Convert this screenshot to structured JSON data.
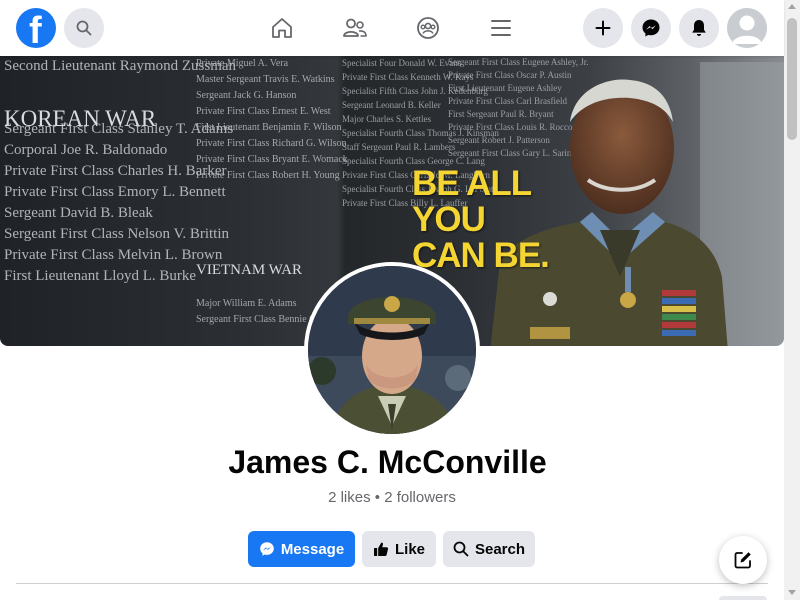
{
  "nav": {
    "logo_letter": "f",
    "icons": [
      "facebook-logo",
      "search-icon",
      "home-icon",
      "friends-icon",
      "groups-icon",
      "menu-icon",
      "plus-icon",
      "messenger-icon",
      "bell-icon",
      "account-avatar"
    ]
  },
  "cover": {
    "heading_korea": "KOREAN WAR",
    "heading_vietnam": "VIETNAM WAR",
    "slogan_line1": "BE ALL",
    "slogan_line2": "YOU",
    "slogan_line3": "CAN BE.",
    "names_left": "Second Lieutenant Raymond Zussman\n\n\nSergeant First Class Stanley T. Adams\nCorporal Joe R. Baldonado\nPrivate First Class Charles H. Barker\nPrivate First Class Emory L. Bennett\nSergeant David B. Bleak\nSergeant First Class Nelson V. Brittin\nPrivate First Class Melvin L. Brown\nFirst Lieutenant Lloyd L. Burke",
    "names_mid": "Private Miguel A. Vera\nMaster Sergeant Travis E. Watkins\nSergeant Jack G. Hanson\nPrivate First Class Ernest E. West\nFirst Lieutenant Benjamin F. Wilson\nPrivate First Class Richard G. Wilson\nPrivate First Class Bryant E. Womack\nPrivate First Class Robert H. Young",
    "names_vietnam": "Major William E. Adams\nSergeant First Class Bennie G. Adkins",
    "names_mid2": "Specialist Four Donald W. Evans\nPrivate First Class Kenneth W. Kays\nSpecialist Fifth Class John J. Kedenburg\nSergeant Leonard B. Keller\nMajor Charles S. Kettles\nSpecialist Fourth Class Thomas J. Kinsman\nStaff Sergeant Paul R. Lambers\nSpecialist Fourth Class George C. Lang\nPrivate First Class Garfield M. Langhorn\nSpecialist Fourth Class Joseph G. LaPointe\nPrivate First Class Billy L. Lauffer",
    "names_right": "Sergeant First Class Eugene Ashley, Jr.\nPrivate First Class Oscar P. Austin\nFirst Lieutenant Eugene Ashley\nPrivate First Class Carl Brasfield\nFirst Sergeant Paul R. Bryant\nPrivate First Class Louis R. Rocco\nSergeant Robert J. Patterson\nSergeant First Class Gary L. Sarin"
  },
  "profile": {
    "name": "James C. McConville",
    "stats": "2 likes • 2 followers"
  },
  "actions": {
    "message_label": "Message",
    "like_label": "Like",
    "search_label": "Search"
  },
  "colors": {
    "brand": "#1877f2",
    "button_gray": "#e4e6eb",
    "slogan_yellow": "#f4d532"
  }
}
